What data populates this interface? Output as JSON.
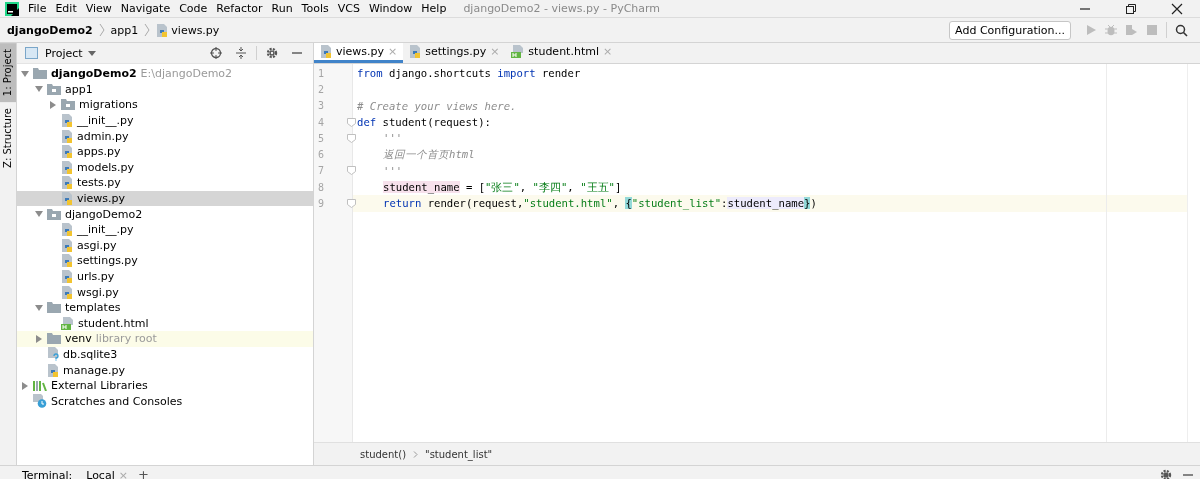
{
  "menu": [
    "File",
    "Edit",
    "View",
    "Navigate",
    "Code",
    "Refactor",
    "Run",
    "Tools",
    "VCS",
    "Window",
    "Help"
  ],
  "window": {
    "title": "djangoDemo2 - views.py - PyCharm"
  },
  "breadcrumb": [
    "djangoDemo2",
    "app1",
    "views.py"
  ],
  "toolbar": {
    "config_button": "Add Configuration..."
  },
  "side_tabs": [
    {
      "label": "1: Project",
      "selected": true
    },
    {
      "label": "Z: Structure",
      "selected": false
    }
  ],
  "project_panel": {
    "title": "Project",
    "tree": [
      {
        "name": "djangoDemo2",
        "hint": "E:\\djangoDemo2",
        "kind": "project",
        "expanded": true,
        "selected": false,
        "children": [
          {
            "name": "app1",
            "kind": "package",
            "expanded": true,
            "selected": false,
            "children": [
              {
                "name": "migrations",
                "kind": "package",
                "expanded": false,
                "selected": false
              },
              {
                "name": "__init__.py",
                "kind": "py",
                "selected": false
              },
              {
                "name": "admin.py",
                "kind": "py",
                "selected": false
              },
              {
                "name": "apps.py",
                "kind": "py",
                "selected": false
              },
              {
                "name": "models.py",
                "kind": "py",
                "selected": false
              },
              {
                "name": "tests.py",
                "kind": "py",
                "selected": false
              },
              {
                "name": "views.py",
                "kind": "py",
                "selected": true
              }
            ]
          },
          {
            "name": "djangoDemo2",
            "kind": "package",
            "expanded": true,
            "selected": false,
            "children": [
              {
                "name": "__init__.py",
                "kind": "py",
                "selected": false
              },
              {
                "name": "asgi.py",
                "kind": "py",
                "selected": false
              },
              {
                "name": "settings.py",
                "kind": "py",
                "selected": false
              },
              {
                "name": "urls.py",
                "kind": "py",
                "selected": false
              },
              {
                "name": "wsgi.py",
                "kind": "py",
                "selected": false
              }
            ]
          },
          {
            "name": "templates",
            "kind": "folder",
            "expanded": true,
            "selected": false,
            "children": [
              {
                "name": "student.html",
                "kind": "html",
                "selected": false
              }
            ]
          },
          {
            "name": "venv",
            "hint": "library root",
            "kind": "libroot",
            "expanded": false,
            "selected": false
          },
          {
            "name": "db.sqlite3",
            "kind": "unknown",
            "selected": false
          },
          {
            "name": "manage.py",
            "kind": "py",
            "selected": false
          }
        ]
      },
      {
        "name": "External Libraries",
        "kind": "libs",
        "expanded": false,
        "selected": false
      },
      {
        "name": "Scratches and Consoles",
        "kind": "scratch",
        "selected": false
      }
    ]
  },
  "editor_tabs": [
    {
      "label": "views.py",
      "kind": "py",
      "selected": true,
      "close": "×"
    },
    {
      "label": "settings.py",
      "kind": "py",
      "selected": false,
      "close": "×"
    },
    {
      "label": "student.html",
      "kind": "html",
      "selected": false,
      "close": "×"
    }
  ],
  "code": [
    {
      "number": "1",
      "current": false,
      "fold": false,
      "tokens": [
        {
          "t": "from",
          "kind": "kw"
        },
        {
          "t": " django.shortcuts ",
          "kind": "plain"
        },
        {
          "t": "import",
          "kind": "kw"
        },
        {
          "t": " render",
          "kind": "plain"
        }
      ]
    },
    {
      "number": "2",
      "current": false,
      "fold": false
    },
    {
      "number": "3",
      "current": false,
      "fold": false,
      "tokens": [
        {
          "t": "# Create your views here.",
          "kind": "comment"
        }
      ]
    },
    {
      "number": "4",
      "current": false,
      "fold": true,
      "tokens": [
        {
          "t": "def",
          "kind": "kw"
        },
        {
          "t": " student(request):",
          "kind": "plain"
        }
      ],
      "body": [
        {
          "number": "5",
          "current": false,
          "fold": true,
          "tokens": [
            {
              "t": "'''",
              "kind": "doc"
            }
          ]
        },
        {
          "number": "6",
          "current": false,
          "fold": false,
          "tokens": [
            {
              "t": "返回一个首页html",
              "kind": "doc"
            }
          ]
        },
        {
          "number": "7",
          "current": false,
          "fold": true,
          "tokens": [
            {
              "t": "'''",
              "kind": "doc"
            }
          ]
        },
        {
          "number": "8",
          "current": false,
          "fold": false,
          "tokens": [
            {
              "t": "student_name",
              "kind": "vardef"
            },
            {
              "t": " = [",
              "kind": "plain"
            },
            {
              "t": "\"张三\"",
              "kind": "str"
            },
            {
              "t": ", ",
              "kind": "plain"
            },
            {
              "t": "\"李四\"",
              "kind": "str"
            },
            {
              "t": ", ",
              "kind": "plain"
            },
            {
              "t": "\"王五\"",
              "kind": "str"
            },
            {
              "t": "]",
              "kind": "plain"
            }
          ]
        },
        {
          "number": "9",
          "current": true,
          "fold": true,
          "tokens": [
            {
              "t": "return",
              "kind": "kw"
            },
            {
              "t": " render(request,",
              "kind": "plain"
            },
            {
              "t": "\"student.html\"",
              "kind": "str"
            },
            {
              "t": ", ",
              "kind": "plain"
            },
            {
              "t": "{",
              "kind": "brace"
            },
            {
              "t": "\"student_list\"",
              "kind": "str"
            },
            {
              "t": ":",
              "kind": "plain"
            },
            {
              "t": "student_name",
              "kind": "varuse"
            },
            {
              "t": "}",
              "kind": "brace"
            },
            {
              "t": ")",
              "kind": "plain"
            }
          ]
        }
      ]
    }
  ],
  "editor_breadcrumb": [
    "student()",
    "\"student_list\""
  ],
  "bottom_bar": {
    "label": "Terminal:",
    "tab": "Local",
    "close": "×",
    "add": "+"
  }
}
